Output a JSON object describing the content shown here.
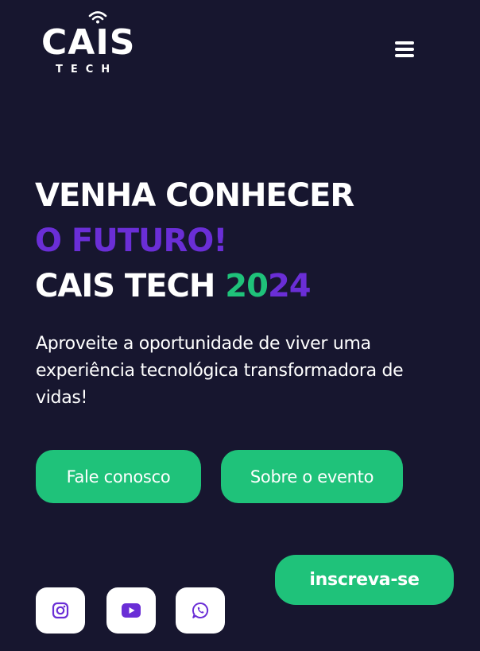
{
  "header": {
    "logo_main": "CAIS",
    "logo_sub": "TECH",
    "menu_icon": "hamburger-menu-icon"
  },
  "hero": {
    "title_line1": "VENHA CONHECER",
    "title_line2": "O FUTURO!",
    "title_line3_prefix": "CAIS TECH ",
    "year_part1": "20",
    "year_part2": "24",
    "description": "Aproveite a oportunidade de viver uma experiência tecnológica transformadora de vidas!"
  },
  "actions": {
    "contact_label": "Fale conosco",
    "about_label": "Sobre o evento",
    "signup_label": "inscreva-se"
  },
  "social": [
    {
      "icon": "instagram-icon"
    },
    {
      "icon": "youtube-icon"
    },
    {
      "icon": "whatsapp-icon"
    }
  ],
  "colors": {
    "background": "#17162f",
    "accent_purple": "#6a2ed6",
    "accent_green": "#1fc27a",
    "text": "#ffffff"
  }
}
